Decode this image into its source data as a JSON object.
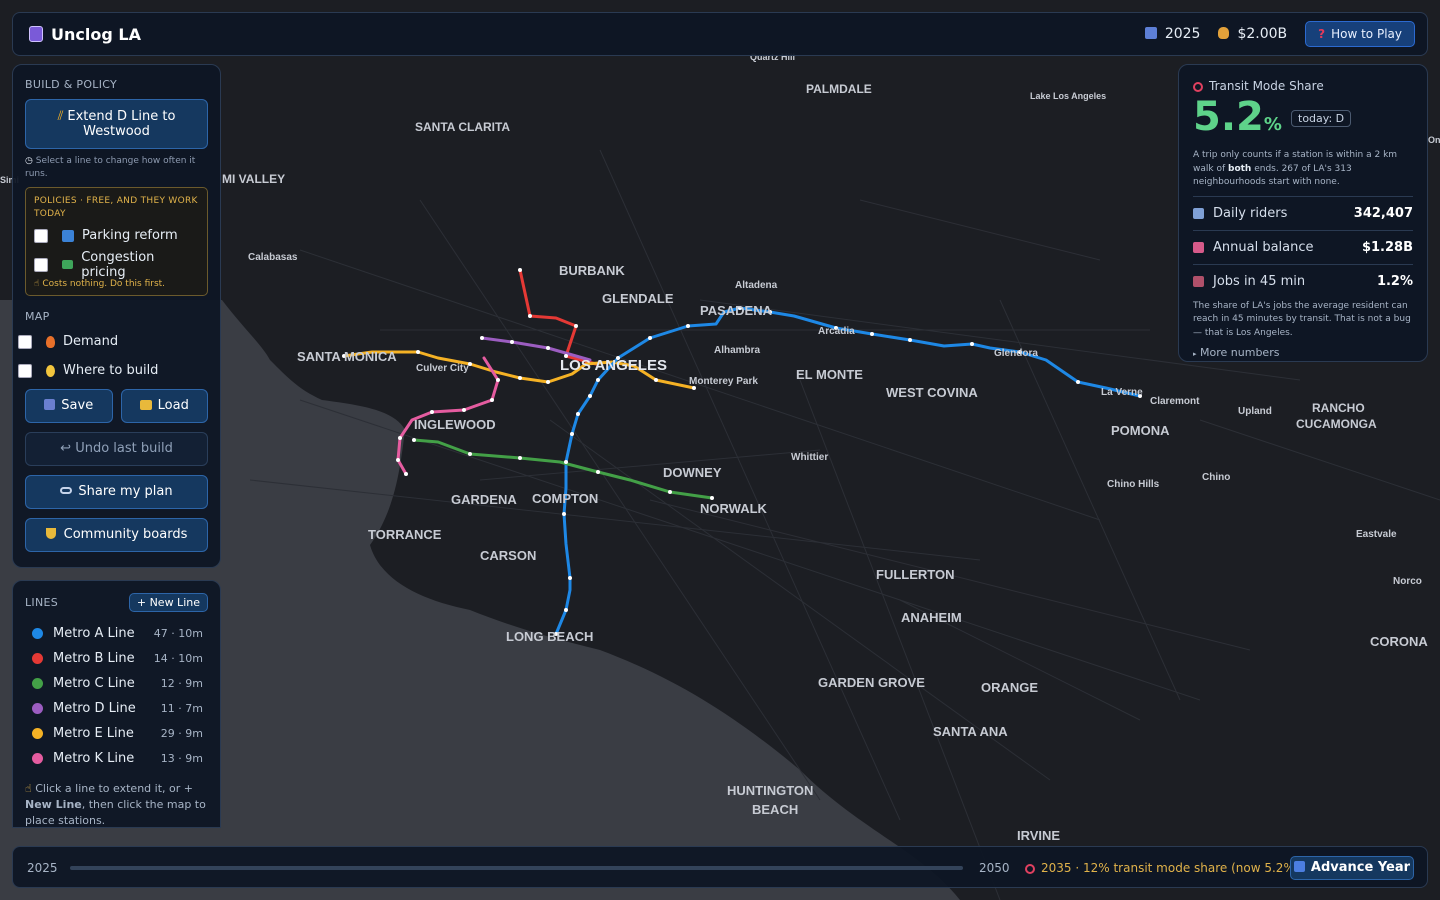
{
  "app": {
    "title": "Unclog LA",
    "year": "2025",
    "budget": "$2.00B",
    "how_to_play": "How to Play"
  },
  "build": {
    "section_title": "BUILD & POLICY",
    "extend_button": "Extend D Line to Westwood",
    "hint": "Select a line to change how often it runs.",
    "policies_title": "POLICIES · FREE, AND THEY WORK TODAY",
    "policies": [
      {
        "label": "Parking reform",
        "checked": false,
        "icon": "parking-icon"
      },
      {
        "label": "Congestion pricing",
        "checked": false,
        "icon": "money-icon"
      }
    ],
    "policies_note": "Costs nothing. Do this first.",
    "map_title": "MAP",
    "map_toggles": [
      {
        "label": "Demand",
        "icon": "fire-icon"
      },
      {
        "label": "Where to build",
        "icon": "bulb-icon"
      }
    ],
    "save": "Save",
    "load": "Load",
    "undo": "Undo last build",
    "share": "Share my plan",
    "community": "Community boards"
  },
  "lines": {
    "title": "LINES",
    "new_line": "+ New Line",
    "items": [
      {
        "name": "Metro A Line",
        "stat": "47 · 10m",
        "color": "#1e88e5"
      },
      {
        "name": "Metro B Line",
        "stat": "14 · 10m",
        "color": "#e53935"
      },
      {
        "name": "Metro C Line",
        "stat": "12 · 9m",
        "color": "#43a047"
      },
      {
        "name": "Metro D Line",
        "stat": "11 · 7m",
        "color": "#9c5dc1"
      },
      {
        "name": "Metro E Line",
        "stat": "29 · 9m",
        "color": "#f5b225"
      },
      {
        "name": "Metro K Line",
        "stat": "13 · 9m",
        "color": "#e55ca0"
      }
    ],
    "hint_a": "Click a line to extend it, or +",
    "hint_b": "New Line",
    "hint_c": ", then click the map to place stations."
  },
  "stats": {
    "title": "Transit Mode Share",
    "share_value": "5.2",
    "share_unit": "%",
    "today": "today: D",
    "desc_a": "A trip only counts if a station is within a 2 km walk of ",
    "desc_b": "both",
    "desc_c": " ends. 267 of LA's 313 neighbourhoods start with none.",
    "rows": [
      {
        "label": "Daily riders",
        "value": "342,407",
        "icon": "riders-icon"
      },
      {
        "label": "Annual balance",
        "value": "$1.28B",
        "icon": "balance-icon"
      },
      {
        "label": "Jobs in 45 min",
        "value": "1.2%",
        "icon": "jobs-icon"
      }
    ],
    "jobs_desc": "The share of LA's jobs the average resident can reach in 45 minutes by transit. That is not a bug — that is Los Angeles.",
    "more": "More numbers"
  },
  "timeline": {
    "start": "2025",
    "end": "2050",
    "goal": "2035 · 12% transit mode share (now 5.2%)",
    "advance": "Advance Year"
  },
  "map_labels": [
    "Quartz Hill",
    "PALMDALE",
    "Lake Los Angeles",
    "SANTA CLARITA",
    "MI VALLEY",
    "Calabasas",
    "BURBANK",
    "GLENDALE",
    "Altadena",
    "PASADENA",
    "Arcadia",
    "Glendora",
    "SANTA MONICA",
    "Culver City",
    "LOS ANGELES",
    "Alhambra",
    "Monterey Park",
    "EL MONTE",
    "WEST COVINA",
    "La Verne",
    "Claremont",
    "Upland",
    "RANCHO CUCAMONGA",
    "POMONA",
    "INGLEWOOD",
    "Whittier",
    "DOWNEY",
    "Chino Hills",
    "Chino",
    "GARDENA",
    "COMPTON",
    "NORWALK",
    "TORRANCE",
    "CARSON",
    "FULLERTON",
    "Eastvale",
    "Norco",
    "ANAHEIM",
    "LONG BEACH",
    "CORONA",
    "GARDEN GROVE",
    "ORANGE",
    "SANTA ANA",
    "HUNTINGTON BEACH",
    "IRVINE",
    "Ontario",
    "Simi"
  ]
}
